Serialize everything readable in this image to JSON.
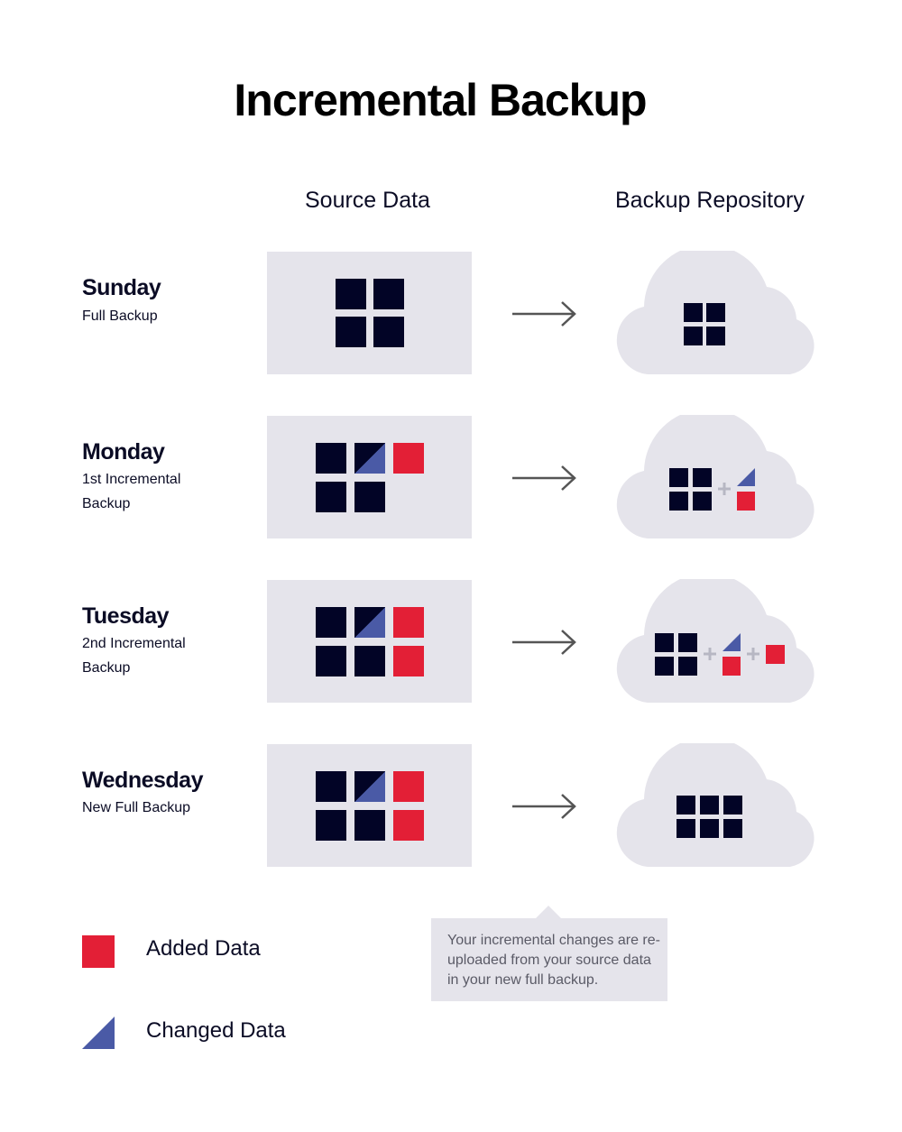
{
  "title": "Incremental Backup",
  "columns": {
    "source": "Source Data",
    "repository": "Backup Repository"
  },
  "rows": [
    {
      "day": "Sunday",
      "subtitle": "Full Backup"
    },
    {
      "day": "Monday",
      "subtitle": "1st Incremental Backup"
    },
    {
      "day": "Tuesday",
      "subtitle": "2nd Incremental Backup"
    },
    {
      "day": "Wednesday",
      "subtitle": "New Full Backup"
    }
  ],
  "note": "Your incremental changes are re-uploaded from your source data in your new full backup.",
  "legend": [
    {
      "label": "Added Data",
      "color": "#e31f36",
      "icon": "red-square"
    },
    {
      "label": "Changed Data",
      "color": "#4a5aa6",
      "icon": "blue-triangle"
    }
  ],
  "colors": {
    "block": "#020426",
    "added": "#e31f36",
    "changed": "#4a5aa6",
    "panel": "#e5e4eb"
  }
}
